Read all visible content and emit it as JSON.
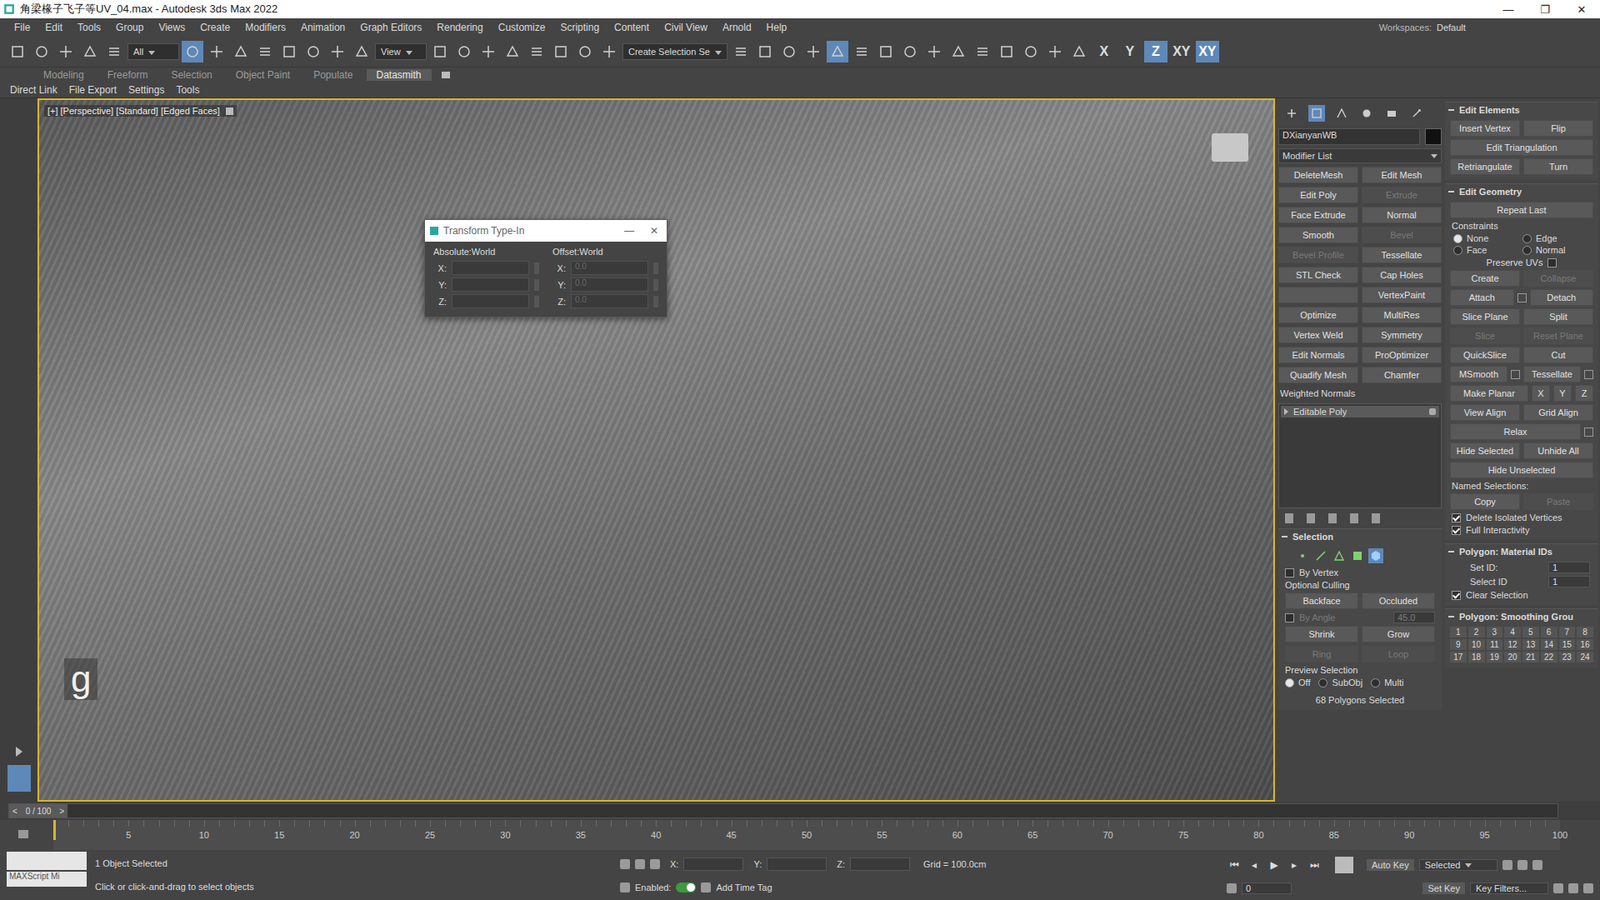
{
  "window": {
    "title": "角梁椽子飞子等UV_04.max - Autodesk 3ds Max 2022",
    "controls": [
      "—",
      "❐",
      "✕"
    ]
  },
  "menu": [
    "File",
    "Edit",
    "Tools",
    "Group",
    "Views",
    "Create",
    "Modifiers",
    "Animation",
    "Graph Editors",
    "Rendering",
    "Customize",
    "Scripting",
    "Content",
    "Civil View",
    "Arnold",
    "Help"
  ],
  "workspace": {
    "label": "Workspaces:",
    "value": "Default"
  },
  "toolbar": {
    "items": [
      {
        "kind": "icon",
        "selected": false
      },
      {
        "kind": "icon",
        "selected": false
      },
      {
        "kind": "icon",
        "selected": false
      },
      {
        "kind": "icon",
        "selected": false
      },
      {
        "kind": "icon",
        "selected": false
      },
      {
        "kind": "dropdown",
        "label": "All"
      },
      {
        "kind": "icon",
        "selected": true
      },
      {
        "kind": "icon",
        "selected": false
      },
      {
        "kind": "icon",
        "selected": false
      },
      {
        "kind": "icon",
        "selected": false
      },
      {
        "kind": "icon",
        "selected": false
      },
      {
        "kind": "icon",
        "selected": false
      },
      {
        "kind": "icon",
        "selected": false
      },
      {
        "kind": "icon",
        "selected": false
      },
      {
        "kind": "dropdown",
        "label": "View"
      },
      {
        "kind": "icon",
        "selected": false
      },
      {
        "kind": "icon",
        "selected": false
      },
      {
        "kind": "icon",
        "selected": false
      },
      {
        "kind": "icon",
        "selected": false
      },
      {
        "kind": "icon",
        "selected": false
      },
      {
        "kind": "icon",
        "selected": false
      },
      {
        "kind": "icon",
        "selected": false
      },
      {
        "kind": "icon",
        "selected": false
      },
      {
        "kind": "field",
        "label": "Create Selection Se"
      },
      {
        "kind": "icon",
        "selected": false
      },
      {
        "kind": "icon",
        "selected": false
      },
      {
        "kind": "icon",
        "selected": false
      },
      {
        "kind": "icon",
        "selected": false
      },
      {
        "kind": "icon",
        "selected": true
      },
      {
        "kind": "icon",
        "selected": false
      },
      {
        "kind": "icon",
        "selected": false
      },
      {
        "kind": "icon",
        "selected": false
      },
      {
        "kind": "icon",
        "selected": false
      },
      {
        "kind": "icon",
        "selected": false
      },
      {
        "kind": "icon",
        "selected": false
      },
      {
        "kind": "icon",
        "selected": false
      },
      {
        "kind": "icon",
        "selected": false
      },
      {
        "kind": "icon",
        "selected": false
      },
      {
        "kind": "icon",
        "selected": false
      },
      {
        "kind": "axis",
        "label": "X",
        "selected": false
      },
      {
        "kind": "axis",
        "label": "Y",
        "selected": false
      },
      {
        "kind": "axis",
        "label": "Z",
        "selected": true
      },
      {
        "kind": "axis",
        "label": "XY",
        "selected": false
      },
      {
        "kind": "axis",
        "label": "XY",
        "selected": true
      }
    ]
  },
  "ribbon_tabs": [
    {
      "label": "Modeling",
      "selected": false
    },
    {
      "label": "Freeform",
      "selected": false
    },
    {
      "label": "Selection",
      "selected": false
    },
    {
      "label": "Object Paint",
      "selected": false
    },
    {
      "label": "Populate",
      "selected": false
    },
    {
      "label": "Datasmith",
      "selected": true
    }
  ],
  "ribbon_sub": [
    "Direct Link",
    "File Export",
    "Settings",
    "Tools"
  ],
  "viewport": {
    "labels": [
      "[+]",
      "[Perspective]",
      "[Standard]",
      "[Edged Faces]"
    ],
    "glyph": "g"
  },
  "dialog": {
    "title": "Transform Type-In",
    "controls": [
      "—",
      "✕"
    ],
    "groups": [
      {
        "label": "Absolute:World",
        "fields": [
          {
            "axis": "X:",
            "value": ""
          },
          {
            "axis": "Y:",
            "value": ""
          },
          {
            "axis": "Z:",
            "value": ""
          }
        ]
      },
      {
        "label": "Offset:World",
        "fields": [
          {
            "axis": "X:",
            "value": "0.0"
          },
          {
            "axis": "Y:",
            "value": "0.0"
          },
          {
            "axis": "Z:",
            "value": "0.0"
          }
        ]
      }
    ]
  },
  "command_panel": {
    "tabs": [
      {
        "selected": false
      },
      {
        "selected": true
      },
      {
        "selected": false
      },
      {
        "selected": false
      },
      {
        "selected": false
      },
      {
        "selected": false
      }
    ],
    "object_name": "DXianyanWB",
    "object_color": "#111111",
    "modifier_list": "Modifier List",
    "modifiers": [
      {
        "label": "DeleteMesh",
        "kind": "button",
        "disabled": false
      },
      {
        "label": "Edit Mesh",
        "kind": "button",
        "disabled": false
      },
      {
        "label": "Edit Poly",
        "kind": "button",
        "disabled": false
      },
      {
        "label": "Extrude",
        "kind": "button",
        "disabled": true
      },
      {
        "label": "Face Extrude",
        "kind": "button",
        "disabled": false
      },
      {
        "label": "Normal",
        "kind": "button",
        "disabled": false
      },
      {
        "label": "Smooth",
        "kind": "button",
        "disabled": false
      },
      {
        "label": "Bevel",
        "kind": "button",
        "disabled": true
      },
      {
        "label": "Bevel Profile",
        "kind": "button",
        "disabled": true
      },
      {
        "label": "Tessellate",
        "kind": "button",
        "disabled": false
      },
      {
        "label": "STL Check",
        "kind": "button",
        "disabled": false
      },
      {
        "label": "Cap Holes",
        "kind": "button",
        "disabled": false
      },
      {
        "label": "",
        "kind": "button",
        "disabled": false
      },
      {
        "label": "VertexPaint",
        "kind": "button",
        "disabled": false
      },
      {
        "label": "Optimize",
        "kind": "button",
        "disabled": false
      },
      {
        "label": "MultiRes",
        "kind": "button",
        "disabled": false
      },
      {
        "label": "Vertex Weld",
        "kind": "button",
        "disabled": false
      },
      {
        "label": "Symmetry",
        "kind": "button",
        "disabled": false
      },
      {
        "label": "Edit Normals",
        "kind": "button",
        "disabled": false
      },
      {
        "label": "ProOptimizer",
        "kind": "button",
        "disabled": false
      },
      {
        "label": "Quadify Mesh",
        "kind": "button",
        "disabled": false
      },
      {
        "label": "Chamfer",
        "kind": "button",
        "disabled": false
      },
      {
        "label": "Weighted Normals",
        "kind": "label",
        "disabled": false
      }
    ],
    "stack": [
      {
        "label": "Editable Poly",
        "expanded": false,
        "selected": true
      }
    ]
  },
  "selection": {
    "title": "Selection",
    "levels": [
      {
        "selected": false
      },
      {
        "selected": false
      },
      {
        "selected": false
      },
      {
        "selected": false
      },
      {
        "selected": true
      }
    ],
    "by_vertex": {
      "label": "By Vertex",
      "checked": false
    },
    "culling_label": "Optional Culling",
    "culling": [
      {
        "label": "Backface",
        "disabled": false
      },
      {
        "label": "Occluded",
        "disabled": false
      }
    ],
    "by_angle": {
      "label": "By Angle",
      "value": "45.0",
      "checked": false,
      "disabled": true
    },
    "buttons": [
      {
        "label": "Shrink",
        "disabled": false
      },
      {
        "label": "Grow",
        "disabled": false
      },
      {
        "label": "Ring",
        "disabled": true
      },
      {
        "label": "Loop",
        "disabled": true
      }
    ],
    "preview_label": "Preview Selection",
    "preview": [
      {
        "label": "Off",
        "selected": true
      },
      {
        "label": "SubObj",
        "selected": false
      },
      {
        "label": "Multi",
        "selected": false
      }
    ],
    "status": "68 Polygons Selected"
  },
  "edit_elements": {
    "title": "Edit Elements",
    "rows": [
      [
        {
          "label": "Insert Vertex",
          "disabled": false,
          "settings": false
        },
        {
          "label": "Flip",
          "disabled": false,
          "settings": false
        }
      ],
      [
        {
          "label": "Edit Triangulation",
          "disabled": false,
          "settings": false
        }
      ],
      [
        {
          "label": "Retriangulate",
          "disabled": false,
          "settings": false
        },
        {
          "label": "Turn",
          "disabled": false,
          "settings": false
        }
      ]
    ]
  },
  "edit_geometry": {
    "title": "Edit Geometry",
    "repeat": "Repeat Last",
    "constraints_label": "Constraints",
    "constraints": [
      {
        "label": "None",
        "selected": true
      },
      {
        "label": "Edge",
        "selected": false
      },
      {
        "label": "Face",
        "selected": false
      },
      {
        "label": "Normal",
        "selected": false
      }
    ],
    "preserve_uvs": {
      "label": "Preserve UVs",
      "checked": false
    },
    "rows": [
      [
        {
          "label": "Create",
          "disabled": false,
          "settings": false
        },
        {
          "label": "Collapse",
          "disabled": true,
          "settings": false
        }
      ],
      [
        {
          "label": "Attach",
          "disabled": false,
          "settings": true
        },
        {
          "label": "Detach",
          "disabled": false,
          "settings": false
        }
      ],
      [
        {
          "label": "Slice Plane",
          "disabled": false,
          "settings": false
        },
        {
          "label": "Split",
          "disabled": false,
          "settings": false
        }
      ],
      [
        {
          "label": "Slice",
          "disabled": true,
          "settings": false
        },
        {
          "label": "Reset Plane",
          "disabled": true,
          "settings": false
        }
      ],
      [
        {
          "label": "QuickSlice",
          "disabled": false,
          "settings": false
        },
        {
          "label": "Cut",
          "disabled": false,
          "settings": false
        }
      ],
      [
        {
          "label": "MSmooth",
          "disabled": false,
          "settings": true
        },
        {
          "label": "Tessellate",
          "disabled": false,
          "settings": true
        }
      ],
      [
        {
          "label": "Make Planar",
          "disabled": false,
          "settings": false
        },
        {
          "label": "X",
          "disabled": false,
          "settings": false
        },
        {
          "label": "Y",
          "disabled": false,
          "settings": false
        },
        {
          "label": "Z",
          "disabled": false,
          "settings": false
        }
      ],
      [
        {
          "label": "View Align",
          "disabled": false,
          "settings": false
        },
        {
          "label": "Grid Align",
          "disabled": false,
          "settings": false
        }
      ],
      [
        {
          "label": "Relax",
          "disabled": false,
          "settings": true
        }
      ],
      [
        {
          "label": "Hide Selected",
          "disabled": false,
          "settings": false
        },
        {
          "label": "Unhide All",
          "disabled": false,
          "settings": false
        }
      ],
      [
        {
          "label": "Hide Unselected",
          "disabled": false,
          "settings": false
        }
      ]
    ],
    "named_label": "Named Selections:",
    "named": [
      {
        "label": "Copy",
        "disabled": false,
        "settings": false
      },
      {
        "label": "Paste",
        "disabled": true,
        "settings": false
      }
    ],
    "checks": [
      {
        "label": "Delete Isolated Vertices",
        "checked": true
      },
      {
        "label": "Full Interactivity",
        "checked": true
      }
    ]
  },
  "material_ids": {
    "title": "Polygon: Material IDs",
    "set_id": {
      "label": "Set ID:",
      "value": "1"
    },
    "select_id": {
      "label": "Select ID",
      "value": "1"
    },
    "clear": {
      "label": "Clear Selection",
      "checked": true
    }
  },
  "smoothing": {
    "title": "Polygon: Smoothing Grou",
    "groups": [
      "1",
      "2",
      "3",
      "4",
      "5",
      "6",
      "7",
      "8",
      "9",
      "10",
      "11",
      "12",
      "13",
      "14",
      "15",
      "16",
      "17",
      "18",
      "19",
      "20",
      "21",
      "22",
      "23",
      "24"
    ]
  },
  "timeline": {
    "frame": "0 / 100",
    "prev": "<",
    "next": ">",
    "level": 0,
    "ticks": [
      "5",
      "10",
      "15",
      "20",
      "25",
      "30",
      "35",
      "40",
      "45",
      "50",
      "55",
      "60",
      "65",
      "70",
      "75",
      "80",
      "85",
      "90",
      "95",
      "100"
    ]
  },
  "status": {
    "listener": "MAXScript Mi",
    "selection": "1 Object Selected",
    "prompt": "Click or click-and-drag to select objects",
    "coords": [
      {
        "axis": "X:",
        "value": ""
      },
      {
        "axis": "Y:",
        "value": ""
      },
      {
        "axis": "Z:",
        "value": ""
      }
    ],
    "grid": "Grid = 100.0cm",
    "time_tag": "Add Time Tag",
    "enabled": {
      "label": "Enabled:",
      "on": true
    },
    "playback": [
      "⏮",
      "◂",
      "▶",
      "▸",
      "⏭"
    ],
    "auto_key": {
      "label": "Auto Key",
      "selected": false
    },
    "key_mode": "Selected",
    "set_key": {
      "label": "Set Key",
      "selected": false
    },
    "key_filters": "Key Filters...",
    "frame": "0"
  }
}
